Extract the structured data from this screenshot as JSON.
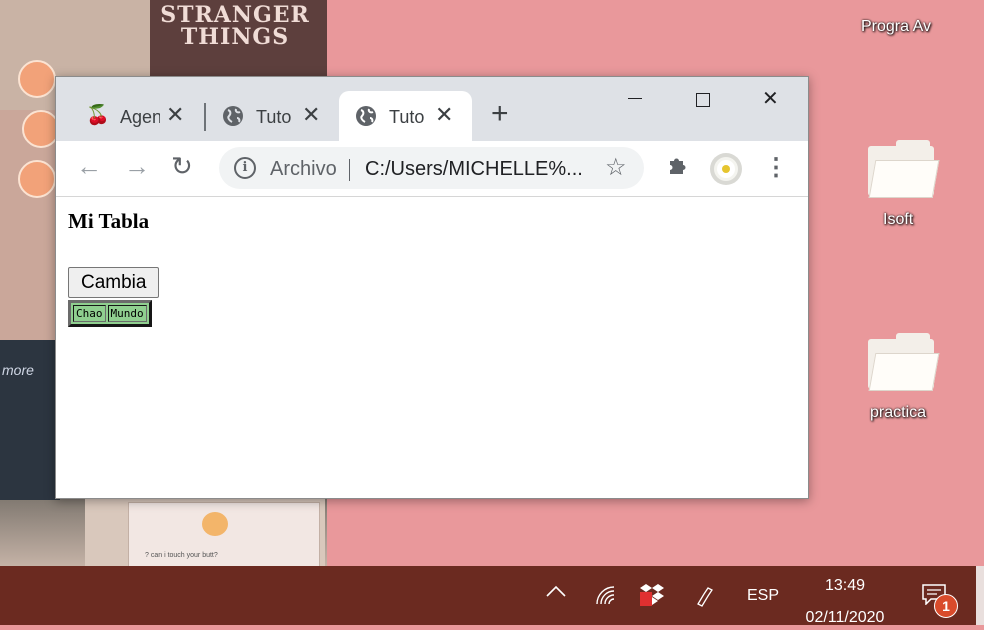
{
  "desktop": {
    "wallpaper_text": "STRANGER THINGS",
    "wallpaper_more": "more",
    "wallpaper_card_text": "? can i touch your butt?",
    "top_label": "Progra Av",
    "icons": [
      {
        "label": "Isoft"
      },
      {
        "label": "practica"
      }
    ]
  },
  "browser": {
    "tabs": [
      {
        "title": "Agen",
        "icon": "cherry-icon",
        "active": false
      },
      {
        "title": "Tuto",
        "icon": "globe-icon",
        "active": false
      },
      {
        "title": "Tuto",
        "icon": "globe-icon",
        "active": true
      }
    ],
    "address": {
      "scheme_label": "Archivo",
      "url": "C:/Users/MICHELLE%..."
    }
  },
  "page": {
    "heading": "Mi Tabla",
    "button_label": "Cambia",
    "table_cells": [
      "Chao",
      "Mundo"
    ],
    "table_bg": "#8fcf8f"
  },
  "taskbar": {
    "language": "ESP",
    "time": "13:49",
    "date": "02/11/2020",
    "notification_count": "1",
    "color": "#6b2a20"
  }
}
